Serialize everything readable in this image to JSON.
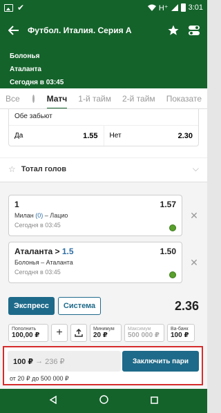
{
  "status": {
    "network": "H⁺",
    "time": "3:01"
  },
  "header": {
    "title": "Футбол. Италия. Серия А"
  },
  "match": {
    "team1": "Болонья",
    "team2": "Аталанта",
    "time": "Сегодня в 03:45"
  },
  "tabs": [
    {
      "label": "Все"
    },
    {
      "label": "Матч"
    },
    {
      "label": "1-й тайм"
    },
    {
      "label": "2-й тайм"
    },
    {
      "label": "Показате"
    }
  ],
  "market": {
    "title": "Обе забьют",
    "options": [
      {
        "label": "Да",
        "odds": "1.55"
      },
      {
        "label": "Нет",
        "odds": "2.30"
      }
    ]
  },
  "total_goals": {
    "label": "Тотал голов"
  },
  "bets": [
    {
      "selection": "1",
      "selection_suffix": "",
      "odds": "1.57",
      "home": "Милан",
      "score": "(0)",
      "away": " – Лацио",
      "time": "Сегодня в 03:45"
    },
    {
      "selection": "Аталанта > ",
      "selection_suffix": "1.5",
      "odds": "1.50",
      "home": "Болонья – Аталанта",
      "score": "",
      "away": "",
      "time": "Сегодня в 03:45"
    }
  ],
  "bet_type": {
    "express": "Экспресс",
    "system": "Система",
    "total_coef": "2.36"
  },
  "quick": {
    "topup_label": "Пополнить",
    "topup_value": "100,00 ₽",
    "min_label": "Минимум",
    "min_value": "20 ₽",
    "max_label": "Максимум",
    "max_value": "500 000 ₽",
    "vabank_label": "Ва-банк",
    "vabank_value": "100 ₽"
  },
  "stake": {
    "amount": "100 ₽",
    "arrow": "→",
    "potential": "236 ₽",
    "button": "Заключить пари",
    "limits": "от 20 ₽ до 500 000 ₽"
  },
  "colors": {
    "brand_green": "#14632b",
    "accent_blue": "#1e6a8a",
    "highlight_red": "#d62b2b"
  }
}
